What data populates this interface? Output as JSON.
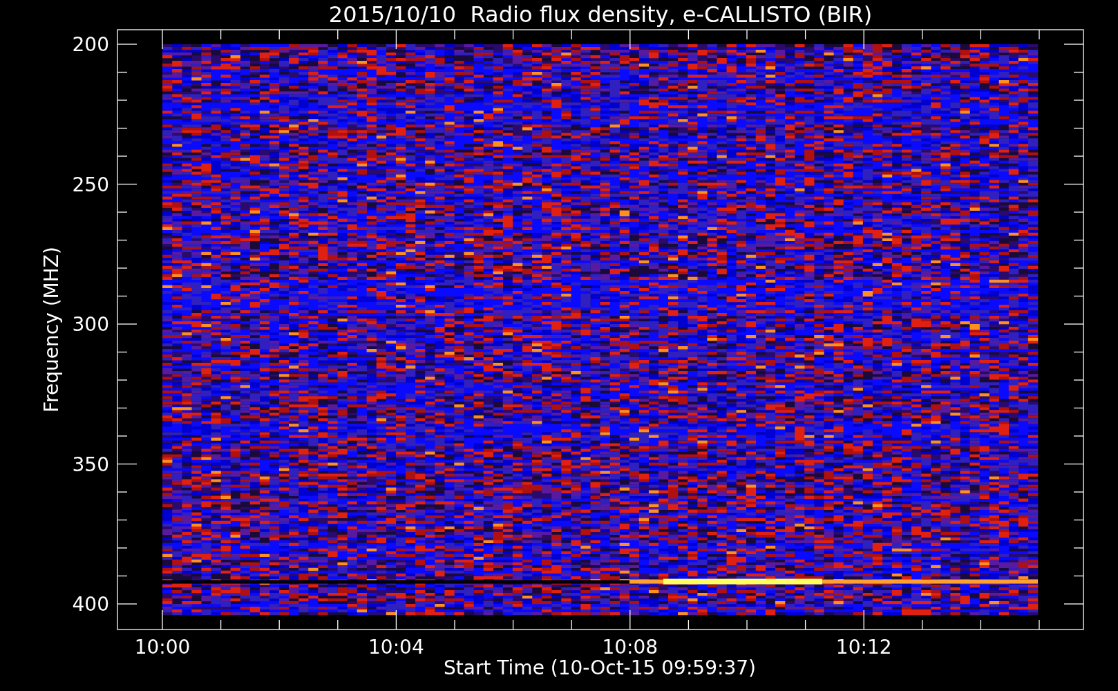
{
  "title": "2015/10/10  Radio flux density, e-CALLISTO (BIR)",
  "y_axis": {
    "label": "Frequency (MHZ)",
    "ticks": [
      "200",
      "250",
      "300",
      "350",
      "400"
    ]
  },
  "x_axis": {
    "label": "Start Time (10-Oct-15 09:59:37)",
    "ticks": [
      "10:00",
      "10:04",
      "10:08",
      "10:12"
    ]
  }
}
